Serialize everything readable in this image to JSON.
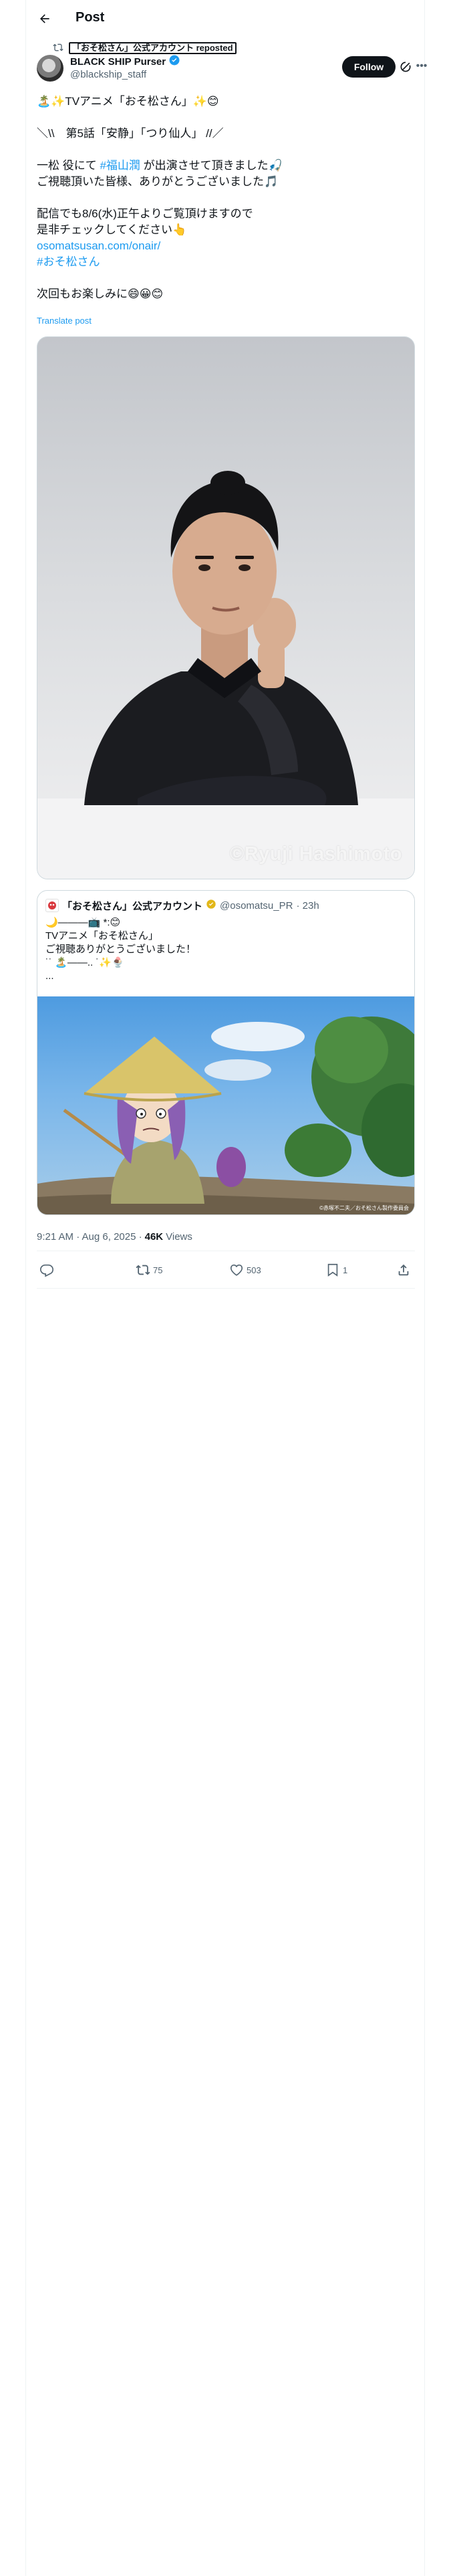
{
  "header": {
    "title": "Post"
  },
  "repost": {
    "text": "「おそ松さん」公式アカウント reposted"
  },
  "author": {
    "name": "BLACK SHIP Purser",
    "handle": "@blackship_staff"
  },
  "follow_label": "Follow",
  "tweet": {
    "lines": [
      "🏝️✨TVアニメ「おそ松さん」✨😊",
      "",
      "＼\\\\　第5話「安静」「つり仙人」 //／",
      "",
      "一松 役にて #福山潤 が出演させて頂きました🎣",
      "ご視聴頂いた皆様、ありがとうございました🎵",
      "",
      "配信でも8/6(水)正午よりご覧頂けますので",
      "是非チェックしてください👆",
      "osomatsusan.com/onair/",
      "#おそ松さん",
      "",
      "次回もお楽しみに😄😀😊"
    ],
    "line3_prefix": "一松 役にて ",
    "line3_tag": "#福山潤",
    "line3_suffix": " が出演させて頂きました🎣",
    "link": "osomatsusan.com/onair/",
    "hashtag": "#おそ松さん",
    "translate": "Translate post"
  },
  "photo": {
    "credit": "©Ryuji Hashimoto"
  },
  "quote": {
    "name": "「おそ松さん」公式アカウント",
    "handle": "@osomatsu_PR",
    "time": "· 23h",
    "lines": [
      "🌙———📺 *:😊",
      "TVアニメ「おそ松さん」",
      "ご視聴ありがとうございました！",
      "˙˙ 🏝️——.. ˙✨🍨",
      "..."
    ],
    "copyright": "©赤塚不二夫／おそ松さん製作委員会"
  },
  "meta": {
    "time": "9:21 AM · Aug 6, 2025 ·",
    "views_count": "46K",
    "views_label": "Views"
  },
  "actions": {
    "reposts": "75",
    "likes": "503",
    "bookmarks": "1"
  },
  "colors": {
    "accent": "#1d9bf0",
    "text": "#0f1419",
    "secondary": "#536471",
    "border": "#cfd9de"
  },
  "icons": [
    "back-arrow-icon",
    "repost-icon",
    "verified-badge-icon",
    "grok-icon",
    "more-icon",
    "reply-icon",
    "retweet-icon",
    "like-icon",
    "bookmark-icon",
    "share-icon"
  ]
}
